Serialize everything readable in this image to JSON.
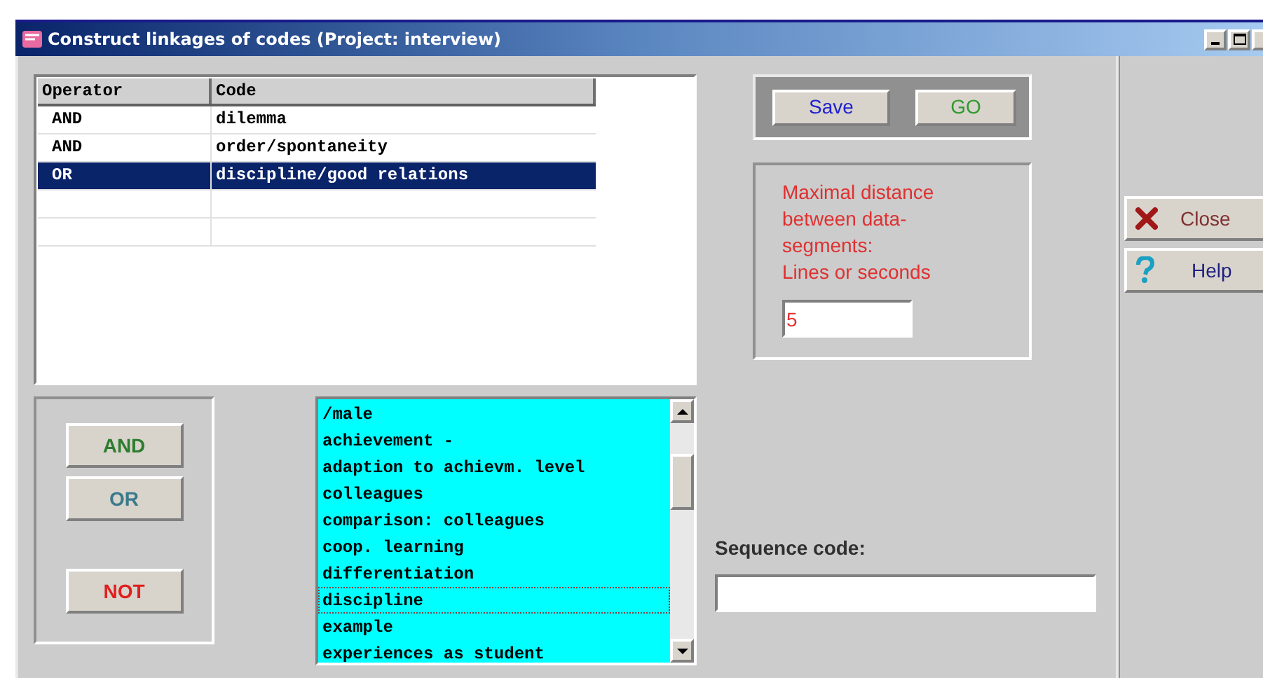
{
  "window": {
    "title": "Construct linkages of codes (Project: interview)"
  },
  "table": {
    "columns": [
      "Operator",
      "Code"
    ],
    "rows": [
      {
        "operator": "AND",
        "code": "dilemma",
        "selected": false
      },
      {
        "operator": "AND",
        "code": "order/spontaneity",
        "selected": false
      },
      {
        "operator": "OR",
        "code": "discipline/good relations",
        "selected": true
      },
      {
        "selected": false
      },
      {
        "selected": false
      }
    ]
  },
  "operator_buttons": [
    {
      "label": "AND",
      "color": "#2e7d2e"
    },
    {
      "label": "OR",
      "color": "#3a7a8a"
    },
    {
      "label": "NOT",
      "color": "#e02020"
    }
  ],
  "code_list": [
    {
      "label": "/male",
      "focused": false
    },
    {
      "label": "achievement -",
      "focused": false
    },
    {
      "label": "adaption to achievm. level",
      "focused": false
    },
    {
      "label": "colleagues",
      "focused": false
    },
    {
      "label": "comparison: colleagues",
      "focused": false
    },
    {
      "label": "coop. learning",
      "focused": false
    },
    {
      "label": "differentiation",
      "focused": false
    },
    {
      "label": "discipline",
      "focused": true
    },
    {
      "label": "example",
      "focused": false
    },
    {
      "label": "experiences as student",
      "focused": false
    }
  ],
  "action_buttons": [
    {
      "label": "Save",
      "color": "#2020d0"
    },
    {
      "label": "GO",
      "color": "#2e9a2e"
    }
  ],
  "distance": {
    "label_lines": [
      "Maximal distance",
      "between data-",
      "segments:",
      "Lines or seconds"
    ],
    "value": "5"
  },
  "sequence": {
    "label": "Sequence code:"
  },
  "side_buttons": [
    {
      "kind": "close",
      "label": "Close"
    },
    {
      "kind": "help",
      "label": "Help"
    }
  ]
}
